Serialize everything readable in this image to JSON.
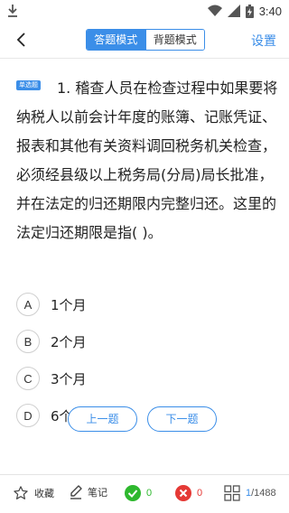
{
  "status_bar": {
    "time": "3:40",
    "download_icon": "download-icon",
    "wifi_icon": "wifi-icon",
    "signal_icon": "signal-icon",
    "battery_icon": "battery-icon"
  },
  "nav": {
    "back_icon": "back-arrow-icon",
    "modes": [
      {
        "label": "答题模式",
        "active": true
      },
      {
        "label": "背题模式",
        "active": false
      }
    ],
    "settings_label": "设置"
  },
  "question": {
    "type_tag": "单选题",
    "text": "1. 稽查人员在检查过程中如果要将纳税人以前会计年度的账簿、记账凭证、报表和其他有关资料调回税务机关检查，必须经县级以上税务局(分局)局长批准，并在法定的归还期限内完整归还。这里的法定归还期限是指( )。"
  },
  "options": [
    {
      "letter": "A",
      "text": "1个月"
    },
    {
      "letter": "B",
      "text": "2个月"
    },
    {
      "letter": "C",
      "text": "3个月"
    },
    {
      "letter": "D",
      "text": "6个月"
    }
  ],
  "buttons": {
    "prev_label": "上一题",
    "next_label": "下一题"
  },
  "bottom_bar": {
    "favorite_label": "收藏",
    "notes_label": "笔记",
    "correct_count": "0",
    "wrong_count": "0",
    "progress_current": "1",
    "progress_total": "/1488"
  },
  "colors": {
    "accent": "#3b8ee8",
    "correct": "#2eb82e",
    "wrong": "#e53935"
  }
}
